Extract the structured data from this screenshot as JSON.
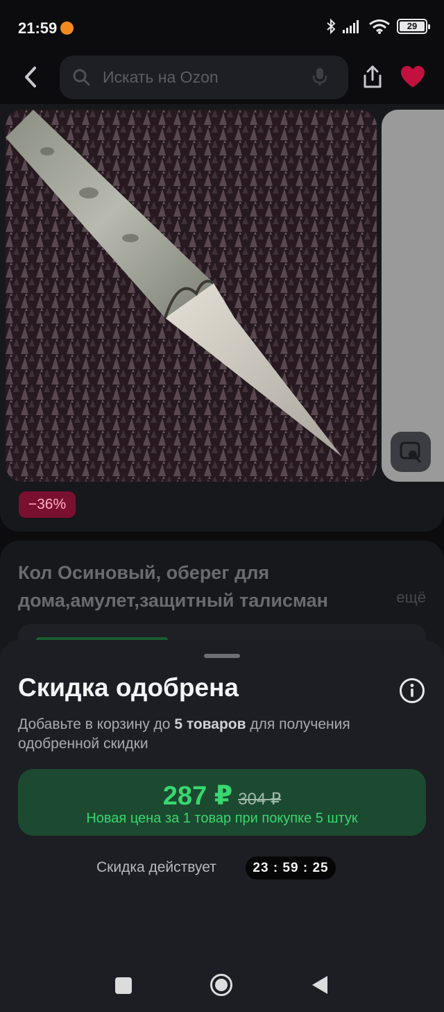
{
  "status_bar": {
    "time": "21:59",
    "battery": "29",
    "battery_level": 0.29,
    "icons": [
      "orange-notification-dot",
      "bluetooth-icon",
      "signal-icon",
      "wifi-icon",
      "battery-icon"
    ]
  },
  "header": {
    "search_placeholder": "Искать на Ozon",
    "icons": [
      "back-arrow-icon",
      "search-icon",
      "microphone-icon",
      "share-icon",
      "heart-icon"
    ],
    "heart_color": "#c2113f"
  },
  "product": {
    "discount_badge": "−36%",
    "title": "Кол Осиновый, оберег для дома,амулет,защитный талисман",
    "more_label": "ещё",
    "image_icon": "aspen-stake-photo",
    "visual_search_icon": "image-search-icon"
  },
  "sheet": {
    "title": "Скидка одобрена",
    "description_prefix": "Добавьте в корзину до ",
    "description_bold": "5 товаров",
    "description_suffix": " для получения одобренной скидки",
    "new_price": "287 ₽",
    "old_price": "304 ₽",
    "price_note": "Новая цена за 1 товар при покупке 5 штук",
    "timer_label": "Скидка действует",
    "timer": "23 : 59 : 25",
    "accent_green": "#38d770",
    "price_box_color": "#1c4a30",
    "info_icon": "info-icon"
  },
  "nav_bar": {
    "icons": [
      "recents-square-icon",
      "home-circle-icon",
      "back-triangle-icon"
    ]
  }
}
